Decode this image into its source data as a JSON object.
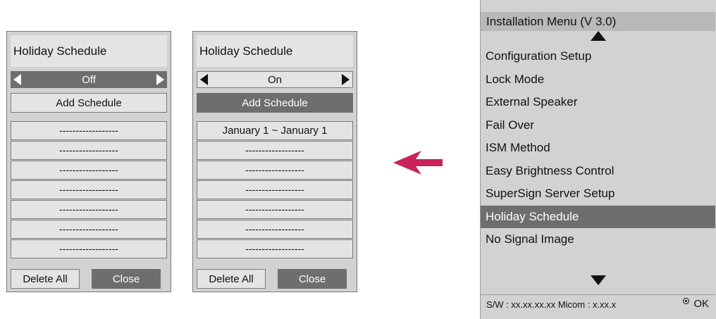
{
  "panel_off": {
    "title": "Holiday Schedule",
    "selector_value": "Off",
    "add_label": "Add Schedule",
    "slots": [
      "------------------",
      "------------------",
      "------------------",
      "------------------",
      "------------------",
      "------------------",
      "------------------"
    ],
    "delete_label": "Delete All",
    "close_label": "Close"
  },
  "panel_on": {
    "title": "Holiday Schedule",
    "selector_value": "On",
    "add_label": "Add Schedule",
    "slots": [
      "January 1 ~ January 1",
      "------------------",
      "------------------",
      "------------------",
      "------------------",
      "------------------",
      "------------------"
    ],
    "delete_label": "Delete All",
    "close_label": "Close"
  },
  "arrow": {
    "color": "#c8235a",
    "icon": "left-arrow-icon"
  },
  "menu": {
    "title": "Installation Menu (V 3.0)",
    "items": [
      "Configuration Setup",
      "Lock Mode",
      "External Speaker",
      "Fail Over",
      "ISM Method",
      "Easy Brightness Control",
      "SuperSign Server Setup",
      "Holiday Schedule",
      "No Signal Image"
    ],
    "selected": "Holiday Schedule",
    "footer": "S/W : xx.xx.xx.xx Micom : x.xx.x",
    "ok_label": "OK"
  }
}
